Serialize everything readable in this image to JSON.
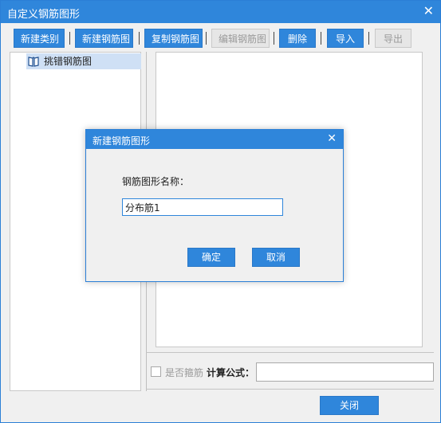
{
  "window": {
    "title": "自定义钢筋图形",
    "close_glyph": "✕"
  },
  "toolbar": {
    "new_category": "新建类别",
    "new_rebar_figure": "新建钢筋图",
    "copy_rebar_figure": "复制钢筋图",
    "edit_rebar_figure": "编辑钢筋图",
    "delete": "删除",
    "import": "导入",
    "export": "导出"
  },
  "tree": {
    "items": [
      {
        "label": "挑错钢筋图",
        "icon": "book-icon"
      }
    ]
  },
  "options": {
    "is_stirrup_label": "是否箍筋",
    "is_stirrup_checked": false,
    "formula_label": "计算公式：",
    "formula_value": ""
  },
  "footer": {
    "close_label": "关闭"
  },
  "dialog": {
    "title": "新建钢筋图形",
    "close_glyph": "✕",
    "name_label": "钢筋图形名称：",
    "name_value": "分布筋1",
    "ok_label": "确定",
    "cancel_label": "取消"
  },
  "colors": {
    "accent": "#2f86db",
    "disabled_bg": "#e6e6e6",
    "selection": "#cfe0f5"
  }
}
